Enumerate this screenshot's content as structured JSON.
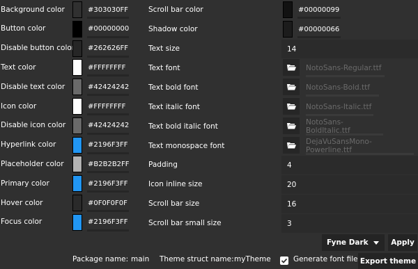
{
  "colors": [
    {
      "label": "Background color",
      "hex": "#303030FF",
      "swatch": "#303030"
    },
    {
      "label": "Button color",
      "hex": "#00000000",
      "swatch": "#000000"
    },
    {
      "label": "Disable button color",
      "hex": "#262626FF",
      "swatch": "#262626"
    },
    {
      "label": "Text color",
      "hex": "#FFFFFFFF",
      "swatch": "#FFFFFF"
    },
    {
      "label": "Disable text color",
      "hex": "#42424242",
      "swatch": "#6a6a6a"
    },
    {
      "label": "Icon color",
      "hex": "#FFFFFFFF",
      "swatch": "#FFFFFF"
    },
    {
      "label": "Disable icon color",
      "hex": "#42424242",
      "swatch": "#6a6a6a"
    },
    {
      "label": "Hyperlink color",
      "hex": "#2196F3FF",
      "swatch": "#2196F3"
    },
    {
      "label": "Placeholder color",
      "hex": "#B2B2B2FF",
      "swatch": "#B2B2B2"
    },
    {
      "label": "Primary color",
      "hex": "#2196F3FF",
      "swatch": "#2196F3"
    },
    {
      "label": "Hover color",
      "hex": "#0F0F0F0F",
      "swatch": "#2a2a2a"
    },
    {
      "label": "Focus color",
      "hex": "#2196F3FF",
      "swatch": "#2196F3"
    }
  ],
  "right_colors": [
    {
      "label": "Scroll bar color",
      "hex": "#00000099",
      "swatch": "#121212"
    },
    {
      "label": "Shadow color",
      "hex": "#00000066",
      "swatch": "#1c1c1c"
    }
  ],
  "text_size": {
    "label": "Text size",
    "value": "14"
  },
  "fonts": [
    {
      "label": "Text font",
      "file": "NotoSans-Regular.ttf"
    },
    {
      "label": "Text bold font",
      "file": "NotoSans-Bold.ttf"
    },
    {
      "label": "Text italic font",
      "file": "NotoSans-Italic.ttf"
    },
    {
      "label": "Text bold italic font",
      "file": "NotoSans-BoldItalic.ttf"
    },
    {
      "label": "Text monospace font",
      "file": "DejaVuSansMono-Powerline.ttf"
    }
  ],
  "sizes": [
    {
      "label": "Padding",
      "value": "4"
    },
    {
      "label": "Icon inline size",
      "value": "20"
    },
    {
      "label": "Scroll bar size",
      "value": "16"
    },
    {
      "label": "Scroll bar small size",
      "value": "3"
    }
  ],
  "theme_select": {
    "value": "Fyne Dark",
    "icon": "caret-down-icon"
  },
  "apply_label": "Apply",
  "package": {
    "label": "Package name:",
    "value": "main"
  },
  "theme_struct": {
    "label": "Theme struct name:",
    "value": "myTheme"
  },
  "generate_font": {
    "label": "Generate font file",
    "checked": true
  },
  "export_label": "Export theme",
  "accent": "#2196F3"
}
